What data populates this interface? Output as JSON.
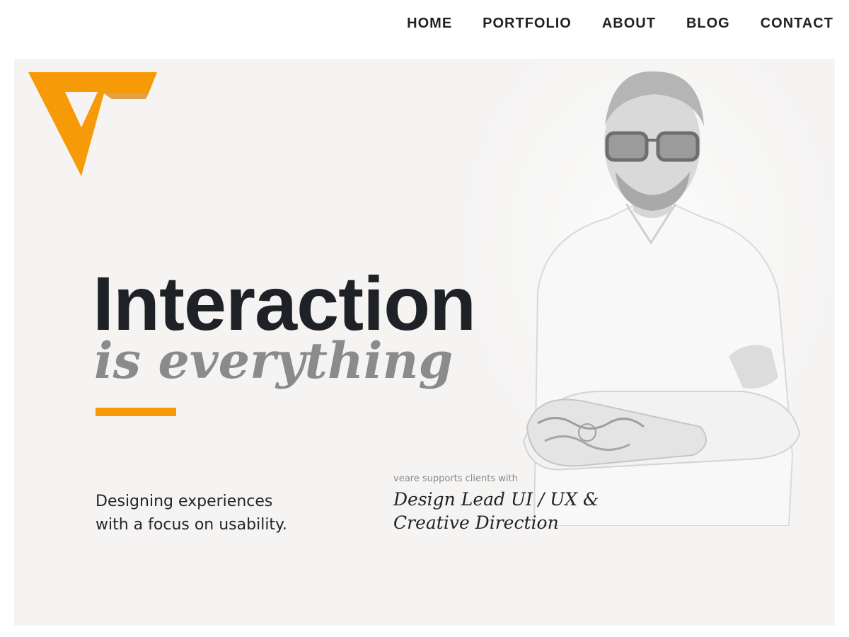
{
  "nav": {
    "items": [
      "HOME",
      "PORTFOLIO",
      "ABOUT",
      "BLOG",
      "CONTACT"
    ]
  },
  "colors": {
    "accent": "#f79a08",
    "hero_background": "#f5f4f3",
    "text_dark": "#1e2226",
    "text_muted": "#8a8b8c"
  },
  "hero": {
    "headline": "Interaction",
    "subheadline": "is everything",
    "tagline": {
      "line1": "Designing experiences",
      "line2": "with a focus on usability."
    },
    "services": {
      "intro": "veare supports clients with",
      "line1": "Design Lead UI / UX &",
      "line2": "Creative Direction"
    }
  }
}
